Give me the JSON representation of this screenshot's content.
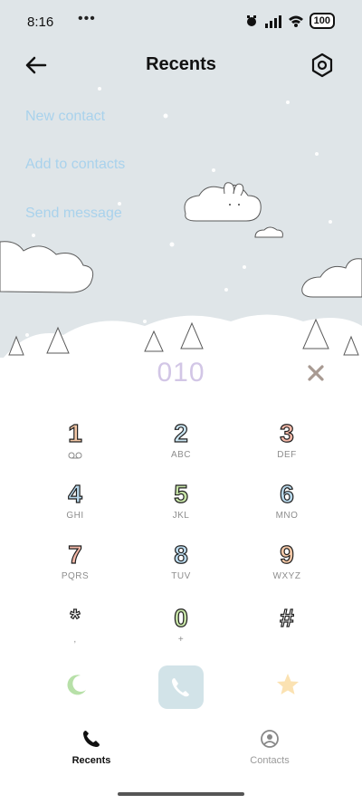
{
  "status": {
    "time": "8:16",
    "dots": "•••",
    "battery": "100"
  },
  "header": {
    "title": "Recents"
  },
  "actions": [
    "New contact",
    "Add to contacts",
    "Send message"
  ],
  "dialer": {
    "number": "010",
    "keys": [
      {
        "digit": "1",
        "letters": "",
        "color": "#f3c7a6"
      },
      {
        "digit": "2",
        "letters": "ABC",
        "color": "#c9e4f1"
      },
      {
        "digit": "3",
        "letters": "DEF",
        "color": "#f4b8a8"
      },
      {
        "digit": "4",
        "letters": "GHI",
        "color": "#b9d9ec"
      },
      {
        "digit": "5",
        "letters": "JKL",
        "color": "#c6e3a6"
      },
      {
        "digit": "6",
        "letters": "MNO",
        "color": "#b9d9ec"
      },
      {
        "digit": "7",
        "letters": "PQRS",
        "color": "#f4b8a8"
      },
      {
        "digit": "8",
        "letters": "TUV",
        "color": "#b9d9ec"
      },
      {
        "digit": "9",
        "letters": "WXYZ",
        "color": "#f3c7a6"
      },
      {
        "digit": "*",
        "letters": ",",
        "color": "#ffffff"
      },
      {
        "digit": "0",
        "letters": "+",
        "color": "#c6e3a6"
      },
      {
        "digit": "#",
        "letters": "",
        "color": "#ffffff"
      }
    ]
  },
  "nav": {
    "recents_label": "Recents",
    "contacts_label": "Contacts"
  },
  "colors": {
    "accent": "#d2e3e8",
    "sky": "#dfe5e8",
    "action_text": "#a9d2ec",
    "number_text": "#d2c6e6"
  }
}
